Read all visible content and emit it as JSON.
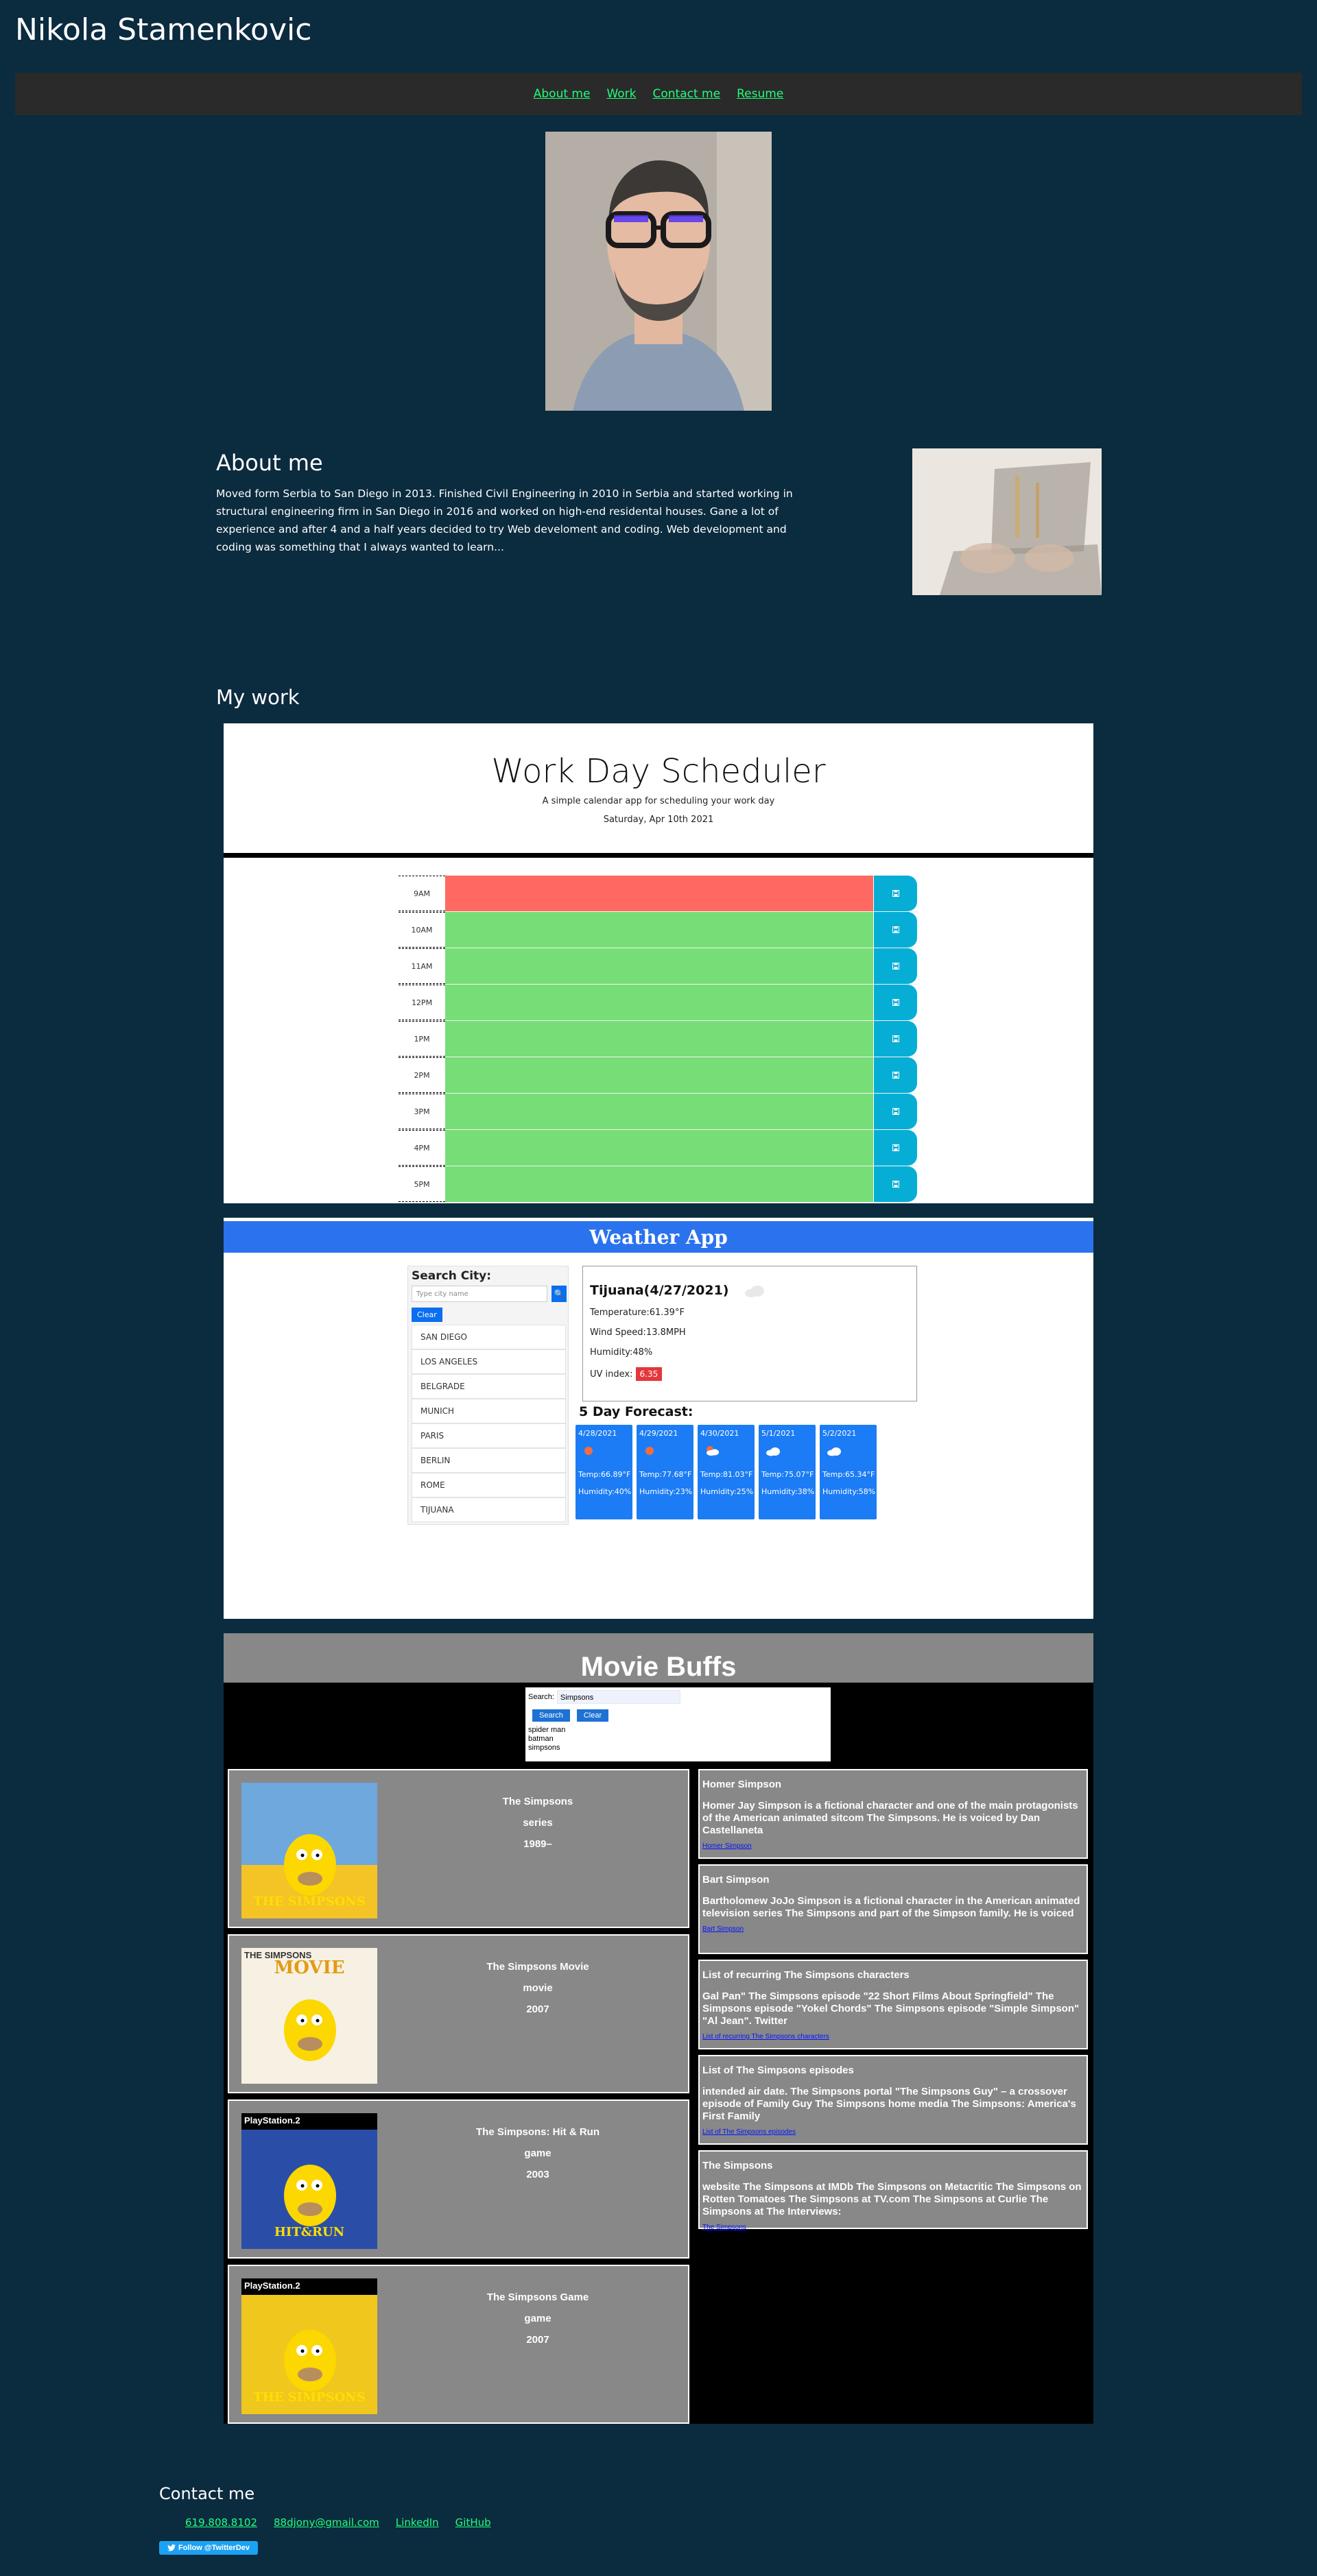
{
  "site": {
    "title": "Nikola Stamenkovic"
  },
  "nav": {
    "items": [
      "About me",
      "Work",
      "Contact me",
      "Resume"
    ]
  },
  "about": {
    "title": "About me",
    "text": "Moved form Serbia to San Diego in 2013. Finished Civil Engineering in 2010 in Serbia and started working in structural engineering firm in San Diego in 2016 and worked on high-end residental houses. Gane a lot of experience and after 4 and a half years decided to try Web develoment and coding. Web development and coding was something that I always wanted to learn..."
  },
  "work": {
    "title": "My work"
  },
  "scheduler": {
    "title": "Work Day Scheduler",
    "subtitle": "A simple calendar app for scheduling your work day",
    "date": "Saturday, Apr 10th 2021",
    "hours": [
      "9AM",
      "10AM",
      "11AM",
      "12PM",
      "1PM",
      "2PM",
      "3PM",
      "4PM",
      "5PM"
    ],
    "status": [
      "past",
      "future",
      "future",
      "future",
      "future",
      "future",
      "future",
      "future",
      "future"
    ],
    "colors": {
      "past": "#ff6961",
      "future": "#77dd77",
      "save": "#06aed5"
    }
  },
  "weather": {
    "title": "Weather App",
    "search_label": "Search City:",
    "search_placeholder": "Type city name",
    "clear_label": "Clear",
    "cities": [
      "SAN DIEGO",
      "LOS ANGELES",
      "BELGRADE",
      "MUNICH",
      "PARIS",
      "BERLIN",
      "ROME",
      "TIJUANA"
    ],
    "current": {
      "title": "Tijuana(4/27/2021)",
      "temperature": "Temperature:61.39°F",
      "wind": "Wind Speed:13.8MPH",
      "humidity": "Humidity:48%",
      "uv_label": "UV index:",
      "uv_value": "6.35",
      "icon": "cloud-icon"
    },
    "forecast_title": "5 Day Forecast:",
    "forecast": [
      {
        "date": "4/28/2021",
        "temp": "Temp:66.89°F",
        "humidity": "Humidity:40%",
        "icon": "sun-icon"
      },
      {
        "date": "4/29/2021",
        "temp": "Temp:77.68°F",
        "humidity": "Humidity:23%",
        "icon": "sun-icon"
      },
      {
        "date": "4/30/2021",
        "temp": "Temp:81.03°F",
        "humidity": "Humidity:25%",
        "icon": "sun-cloud-icon"
      },
      {
        "date": "5/1/2021",
        "temp": "Temp:75.07°F",
        "humidity": "Humidity:38%",
        "icon": "cloud-icon"
      },
      {
        "date": "5/2/2021",
        "temp": "Temp:65.34°F",
        "humidity": "Humidity:58%",
        "icon": "cloud-icon"
      }
    ]
  },
  "movie": {
    "title": "Movie Buffs",
    "search_label": "Search:",
    "search_value": "Simpsons",
    "search_button": "Search",
    "clear_button": "Clear",
    "history": [
      "spider man",
      "batman",
      "simpsons"
    ],
    "results": [
      {
        "title": "The Simpsons",
        "type": "series",
        "year": "1989–"
      },
      {
        "title": "The Simpsons Movie",
        "type": "movie",
        "year": "2007"
      },
      {
        "title": "The Simpsons: Hit & Run",
        "type": "game",
        "year": "2003"
      },
      {
        "title": "The Simpsons Game",
        "type": "game",
        "year": "2007"
      }
    ],
    "wiki": [
      {
        "title": "Homer Simpson",
        "text": "Homer Jay Simpson is a fictional character and one of the main protagonists of the American animated sitcom The Simpsons. He is voiced by Dan Castellaneta",
        "link": "Homer Simpson"
      },
      {
        "title": "Bart Simpson",
        "text": "Bartholomew JoJo Simpson is a fictional character in the American animated television series The Simpsons and part of the Simpson family. He is voiced",
        "link": "Bart Simpson"
      },
      {
        "title": "List of recurring The Simpsons characters",
        "text": "Gal Pan\" The Simpsons episode \"22 Short Films About Springfield\" The Simpsons episode \"Yokel Chords\" The Simpsons episode \"Simple Simpson\" \"Al Jean\". Twitter",
        "link": "List of recurring The Simpsons characters"
      },
      {
        "title": "List of The Simpsons episodes",
        "text": "intended air date. The Simpsons portal \"The Simpsons Guy\" – a crossover episode of Family Guy The Simpsons home media The Simpsons: America's First Family",
        "link": "List of The Simpsons episodes"
      },
      {
        "title": "The Simpsons",
        "text": "website The Simpsons at IMDb The Simpsons on Metacritic The Simpsons on Rotten Tomatoes The Simpsons at TV.com The Simpsons at Curlie The Simpsons at The Interviews:",
        "link": "The Simpsons"
      }
    ],
    "posters": [
      {
        "badge": "",
        "caption": "THE SIMPSONS"
      },
      {
        "badge": "THE SIMPSONS",
        "caption": "MOVIE"
      },
      {
        "badge": "PlayStation.2",
        "caption": "HIT&RUN"
      },
      {
        "badge": "PlayStation.2",
        "caption": "THE SIMPSONS"
      }
    ]
  },
  "contact": {
    "title": "Contact me",
    "links": [
      "619.808.8102",
      "88djony@gmail.com",
      "LinkedIn",
      "GitHub"
    ],
    "twitter_button": "Follow @TwitterDev"
  }
}
